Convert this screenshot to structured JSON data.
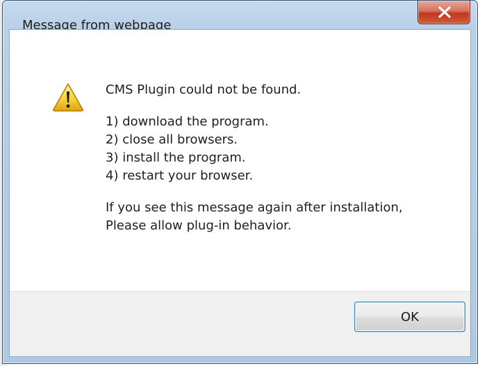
{
  "dialog": {
    "title": "Message from webpage",
    "close_glyph": "x",
    "icon": "warning-icon",
    "message_lines": [
      "CMS Plugin could not be found.",
      "",
      "1) download the program.",
      "2) close all browsers.",
      "3) install the program.",
      "4) restart your browser.",
      "",
      "If you see this message again after installation,",
      "Please allow plug-in behavior."
    ],
    "ok_label": "OK"
  },
  "colors": {
    "title_bar": "#b9d0e8",
    "close_button": "#c0391f",
    "footer": "#f0f0f0",
    "ok_border": "#3c7fb1"
  }
}
